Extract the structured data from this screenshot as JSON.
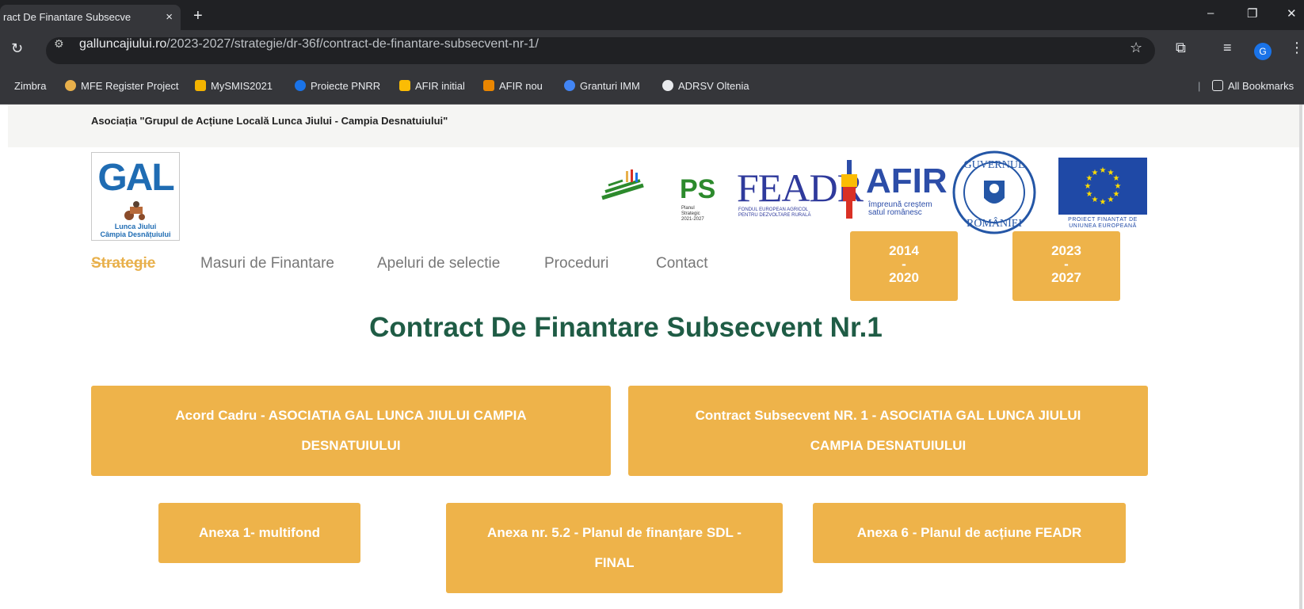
{
  "browser": {
    "tab_title": "ract De Finantare Subsecve",
    "tab_close": "×",
    "new_tab": "+",
    "url_host": "galluncajiului.ro",
    "url_path": "/2023-2027/strategie/dr-36f/contract-de-finantare-subsecvent-nr-1/",
    "window_controls": [
      "–",
      "❐",
      "✕"
    ],
    "profile_initial": "G"
  },
  "bookmarks": {
    "items": [
      {
        "label": "Zimbra",
        "color": "#35363a"
      },
      {
        "label": "MFE Register Project",
        "color": "#e8b04b"
      },
      {
        "label": "MySMIS2021",
        "color": "#f4b400"
      },
      {
        "label": "Proiecte PNRR",
        "color": "#1a73e8"
      },
      {
        "label": "AFIR initial",
        "color": "#fbbc04"
      },
      {
        "label": "AFIR nou",
        "color": "#ea8600"
      },
      {
        "label": "Granturi IMM",
        "color": "#4285f4"
      },
      {
        "label": "ADRSV Oltenia",
        "color": "#e8eaed"
      }
    ],
    "all_bookmarks": "All Bookmarks"
  },
  "site": {
    "org_name": "Asociația \"Grupul de Acțiune Locală Lunca Jiului - Campia Desnatuiului\"",
    "logo_text": "GAL",
    "logo_caption_1": "Lunca Jiului",
    "logo_caption_2": "Câmpia Desnățuiului",
    "partners": {
      "ps": "PS",
      "ps_small": "Planul Strategic 2021-2027",
      "feadr": "FEADR",
      "feadr_sub": "FONDUL EUROPEAN AGRICOL PENTRU DEZVOLTARE RURALĂ",
      "afir": "AFIR",
      "afir_sub": "împreună creștem satul românesc",
      "eu_sub": "PROIECT FINANȚAT DE UNIUNEA EUROPEANĂ"
    },
    "nav": [
      {
        "label": "Strategie",
        "active": true
      },
      {
        "label": "Masuri de Finantare",
        "active": false
      },
      {
        "label": "Apeluri de selectie",
        "active": false
      },
      {
        "label": "Proceduri",
        "active": false
      },
      {
        "label": "Contact",
        "active": false
      }
    ],
    "periods": [
      {
        "start": "2014",
        "sep": "-",
        "end": "2020"
      },
      {
        "start": "2023",
        "sep": "-",
        "end": "2027"
      }
    ],
    "page_title": "Contract De Finantare Subsecvent Nr.1",
    "documents": [
      "Acord Cadru - ASOCIATIA GAL LUNCA JIULUI CAMPIA DESNATUIULUI",
      "Contract Subsecvent NR. 1 - ASOCIATIA GAL LUNCA JIULUI CAMPIA DESNATUIULUI",
      "Anexa 1- multifond",
      "Anexa nr. 5.2 - Planul de finanțare SDL - FINAL",
      "Anexa 6 - Planul de acțiune FEADR"
    ],
    "accent_color": "#eeb34a",
    "title_color": "#1f5c45"
  }
}
